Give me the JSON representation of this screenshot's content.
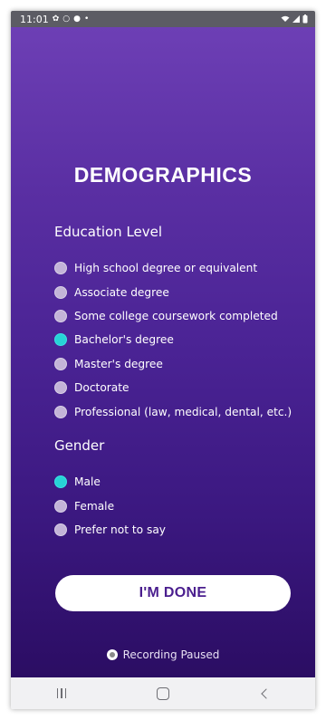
{
  "status_bar": {
    "time": "11:01",
    "left_icons": [
      "settings-icon",
      "circle-icon",
      "location-icon",
      "dot-icon"
    ],
    "right_icons": [
      "wifi-icon",
      "signal-icon",
      "battery-icon"
    ]
  },
  "page": {
    "title": "DEMOGRAPHICS"
  },
  "education": {
    "heading": "Education Level",
    "selected": "Bachelor's degree",
    "options": [
      "High school degree or equivalent",
      "Associate degree",
      "Some college coursework completed",
      "Bachelor's degree",
      "Master's degree",
      "Doctorate",
      "Professional (law, medical, dental, etc.)"
    ]
  },
  "gender": {
    "heading": "Gender",
    "selected": "Male",
    "options": [
      "Male",
      "Female",
      "Prefer not to say"
    ]
  },
  "done_button": {
    "label": "I'M DONE"
  },
  "recording": {
    "label": "Recording Paused"
  },
  "colors": {
    "gradient_top": "#6d3fb5",
    "gradient_bottom": "#2b0d63",
    "radio_selected": "#27d3d6",
    "radio_unselected": "#c3b4d8",
    "button_text": "#4a1e8e"
  },
  "nav_bar": {
    "buttons": [
      "recent-apps-icon",
      "home-icon",
      "back-icon"
    ]
  }
}
